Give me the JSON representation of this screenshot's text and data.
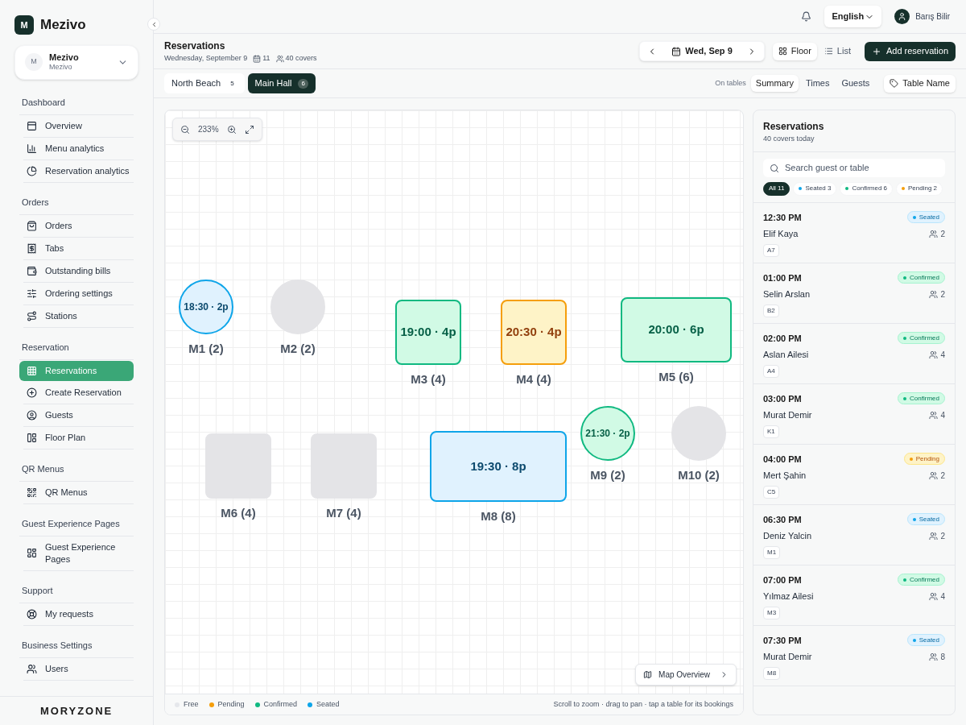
{
  "brand": {
    "logo_letter": "M",
    "name": "Mezivo"
  },
  "workspace": {
    "avatar_letter": "M",
    "name": "Mezivo",
    "subtitle": "Mezivo"
  },
  "sidebar": {
    "sections": [
      {
        "title": "Dashboard",
        "items": [
          {
            "label": "Overview",
            "selected": false
          },
          {
            "label": "Menu analytics",
            "selected": false
          },
          {
            "label": "Reservation analytics",
            "selected": false
          }
        ]
      },
      {
        "title": "Orders",
        "items": [
          {
            "label": "Orders",
            "selected": false
          },
          {
            "label": "Tabs",
            "selected": false
          },
          {
            "label": "Outstanding bills",
            "selected": false
          },
          {
            "label": "Ordering settings",
            "selected": false
          },
          {
            "label": "Stations",
            "selected": false
          }
        ]
      },
      {
        "title": "Reservation",
        "items": [
          {
            "label": "Reservations",
            "selected": true
          },
          {
            "label": "Create Reservation",
            "selected": false
          },
          {
            "label": "Guests",
            "selected": false
          },
          {
            "label": "Floor Plan",
            "selected": false
          }
        ]
      },
      {
        "title": "QR Menus",
        "items": [
          {
            "label": "QR Menus",
            "selected": false
          }
        ]
      },
      {
        "title": "Guest Experience Pages",
        "items": [
          {
            "label": "Guest Experience Pages",
            "selected": false
          }
        ]
      },
      {
        "title": "Support",
        "items": [
          {
            "label": "My requests",
            "selected": false
          }
        ]
      },
      {
        "title": "Business Settings",
        "items": [
          {
            "label": "Users",
            "selected": false
          }
        ]
      }
    ],
    "footer_logo": "MORYZONE"
  },
  "topbar": {
    "language": "English",
    "user": "Barış Bilir"
  },
  "header": {
    "title": "Reservations",
    "date": "Wednesday, September 9",
    "bookings": "11",
    "covers": "40 covers",
    "current_date": "Wed, Sep 9",
    "views": [
      {
        "label": "Floor",
        "selected": true
      },
      {
        "label": "List",
        "selected": false
      }
    ],
    "add_button": "Add reservation"
  },
  "areas": [
    {
      "label": "North Beach",
      "count": "5",
      "selected": false
    },
    {
      "label": "Main Hall",
      "count": "6",
      "selected": true
    }
  ],
  "display": {
    "label": "On tables",
    "options": [
      {
        "label": "Summary",
        "selected": true
      },
      {
        "label": "Times",
        "selected": false
      },
      {
        "label": "Guests",
        "selected": false
      }
    ],
    "table_name_button": "Table Name"
  },
  "floor": {
    "zoom": "233%",
    "tables": [
      {
        "name": "M1 (2)",
        "kind": "seated",
        "booking": "18:30 · 2p"
      },
      {
        "name": "M2 (2)",
        "kind": "free"
      },
      {
        "name": "M3 (4)",
        "kind": "confirmed",
        "booking": "19:00 · 4p"
      },
      {
        "name": "M4 (4)",
        "kind": "pending",
        "booking": "20:30 · 4p"
      },
      {
        "name": "M5 (6)",
        "kind": "confirmed",
        "booking": "20:00 · 6p"
      },
      {
        "name": "M6 (4)",
        "kind": "free"
      },
      {
        "name": "M7 (4)",
        "kind": "free"
      },
      {
        "name": "M8 (8)",
        "kind": "seated",
        "booking": "19:30 · 8p"
      },
      {
        "name": "M9 (2)",
        "kind": "confirmed",
        "booking": "21:30 · 2p"
      },
      {
        "name": "M10 (2)",
        "kind": "free"
      }
    ],
    "map_overview": "Map Overview",
    "legend": [
      {
        "label": "Free",
        "color": "#e5e7eb"
      },
      {
        "label": "Pending",
        "color": "#f59e0b"
      },
      {
        "label": "Confirmed",
        "color": "#10b981"
      },
      {
        "label": "Seated",
        "color": "#0ea5e9"
      }
    ],
    "hint": "Scroll to zoom · drag to pan · tap a table for its bookings"
  },
  "panel": {
    "title": "Reservations",
    "subtitle": "40 covers today",
    "search_placeholder": "Search guest or table",
    "filters": [
      {
        "label": "All 11",
        "selected": true
      },
      {
        "label": "Seated 3",
        "selected": false,
        "color": "#0ea5e9"
      },
      {
        "label": "Confirmed 6",
        "selected": false,
        "color": "#10b981"
      },
      {
        "label": "Pending 2",
        "selected": false,
        "color": "#f59e0b"
      }
    ],
    "reservations": [
      {
        "time": "12:30 PM",
        "kind": "seated",
        "status_label": "Seated",
        "guest": "Elif Kaya",
        "party": "2",
        "table": "A7"
      },
      {
        "time": "01:00 PM",
        "kind": "confirmed",
        "status_label": "Confirmed",
        "guest": "Selin Arslan",
        "party": "2",
        "table": "B2"
      },
      {
        "time": "02:00 PM",
        "kind": "confirmed",
        "status_label": "Confirmed",
        "guest": "Aslan Ailesi",
        "party": "4",
        "table": "A4"
      },
      {
        "time": "03:00 PM",
        "kind": "confirmed",
        "status_label": "Confirmed",
        "guest": "Murat Demir",
        "party": "4",
        "table": "K1"
      },
      {
        "time": "04:00 PM",
        "kind": "pending",
        "status_label": "Pending",
        "guest": "Mert Şahin",
        "party": "2",
        "table": "C5"
      },
      {
        "time": "06:30 PM",
        "kind": "seated",
        "status_label": "Seated",
        "guest": "Deniz Yalcin",
        "party": "2",
        "table": "M1"
      },
      {
        "time": "07:00 PM",
        "kind": "confirmed",
        "status_label": "Confirmed",
        "guest": "Yılmaz Ailesi",
        "party": "4",
        "table": "M3"
      },
      {
        "time": "07:30 PM",
        "kind": "seated",
        "status_label": "Seated",
        "guest": "Murat Demir",
        "party": "8",
        "table": "M8"
      }
    ]
  }
}
